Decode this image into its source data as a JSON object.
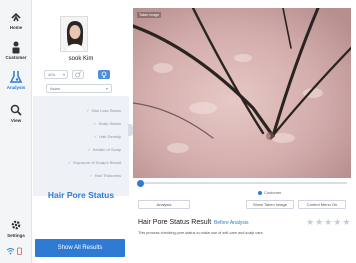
{
  "rail": {
    "items": [
      {
        "label": "Home",
        "icon": "home-icon"
      },
      {
        "label": "Customer",
        "icon": "customer-icon"
      },
      {
        "label": "Analysis",
        "icon": "analysis-icon"
      },
      {
        "label": "View",
        "icon": "view-icon"
      }
    ],
    "settings_label": "Settings",
    "accent": "#2f7bd4"
  },
  "customer": {
    "name": "sook Kim",
    "age_value": "40's",
    "type_value": "Asian"
  },
  "analysis": {
    "checklist": [
      "Hair Loss Status",
      "Scalp Status",
      "Hair Density",
      "Keratin of Scalp",
      "Exposure of Scalp's Result",
      "Hair Thickness"
    ],
    "current_section": "Hair Pore Status",
    "show_all_label": "Show All Results"
  },
  "viewer": {
    "tag": "Taken Image",
    "legend_label": "Customer",
    "buttons": {
      "analysis": "Analysis",
      "show_taken": "Show Taken Image",
      "control_menu": "Control Menu On"
    }
  },
  "result": {
    "title": "Hair Pore Status Result",
    "link": "Before Analysis",
    "rating": 0,
    "description": "This process checking pore status to make use of self-care and scalp care."
  }
}
